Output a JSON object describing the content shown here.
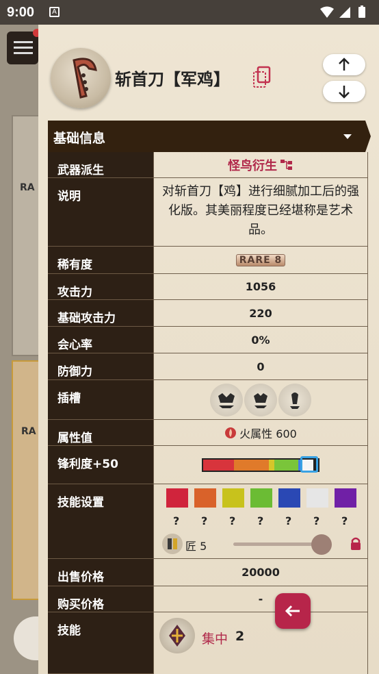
{
  "status_bar": {
    "time": "9:00",
    "notif_icon": "A"
  },
  "background": {
    "rarity_label": "RA"
  },
  "header": {
    "title": "斩首刀【军鸡】",
    "icon": "weapon-icon",
    "up_icon": "arrow-up-icon",
    "down_icon": "arrow-down-icon",
    "copy_icon": "copy-icon"
  },
  "section": {
    "title": "基础信息"
  },
  "table": {
    "derivation": {
      "label": "武器派生",
      "value": "怪鸟衍生"
    },
    "description": {
      "label": "说明",
      "value": "对斩首刀【鸡】进行细腻加工后的强化版。其美丽程度已经堪称是艺术品。"
    },
    "rarity": {
      "label": "稀有度",
      "value": "RARE 8"
    },
    "attack": {
      "label": "攻击力",
      "value": "1056"
    },
    "base_attack": {
      "label": "基础攻击力",
      "value": "220"
    },
    "affinity": {
      "label": "会心率",
      "value": "0%"
    },
    "defense": {
      "label": "防御力",
      "value": "0"
    },
    "slots": {
      "label": "插槽",
      "levels": [
        4,
        3,
        1
      ]
    },
    "element": {
      "label": "属性值",
      "value": "火属性 600"
    },
    "sharpness": {
      "label": "锋利度+50",
      "segments": [
        {
          "color": "#d8343c",
          "fraction": 0.27
        },
        {
          "color": "#e07a2a",
          "fraction": 0.3
        },
        {
          "color": "#d6c62a",
          "fraction": 0.05
        },
        {
          "color": "#7ac53a",
          "fraction": 0.21
        },
        {
          "color": "#3f7ce8",
          "fraction": 0.02
        },
        {
          "color": "#f5f5f5",
          "fraction": 0.11
        }
      ]
    },
    "skill_settings": {
      "label": "技能设置",
      "gem_colors": [
        "#d0243c",
        "#d9622a",
        "#c8c21c",
        "#6bbc34",
        "#2a48b4",
        "#e6e6e6",
        "#7020a6"
      ],
      "unknown": "?",
      "craft_label": "匠 5",
      "level": 5
    },
    "sell_price": {
      "label": "出售价格",
      "value": "20000"
    },
    "buy_price": {
      "label": "购买价格",
      "value": "-"
    },
    "skills": {
      "label": "技能",
      "items": [
        {
          "name": "集中",
          "level": "2"
        }
      ]
    }
  },
  "fab": {
    "icon": "back-arrow-icon"
  }
}
